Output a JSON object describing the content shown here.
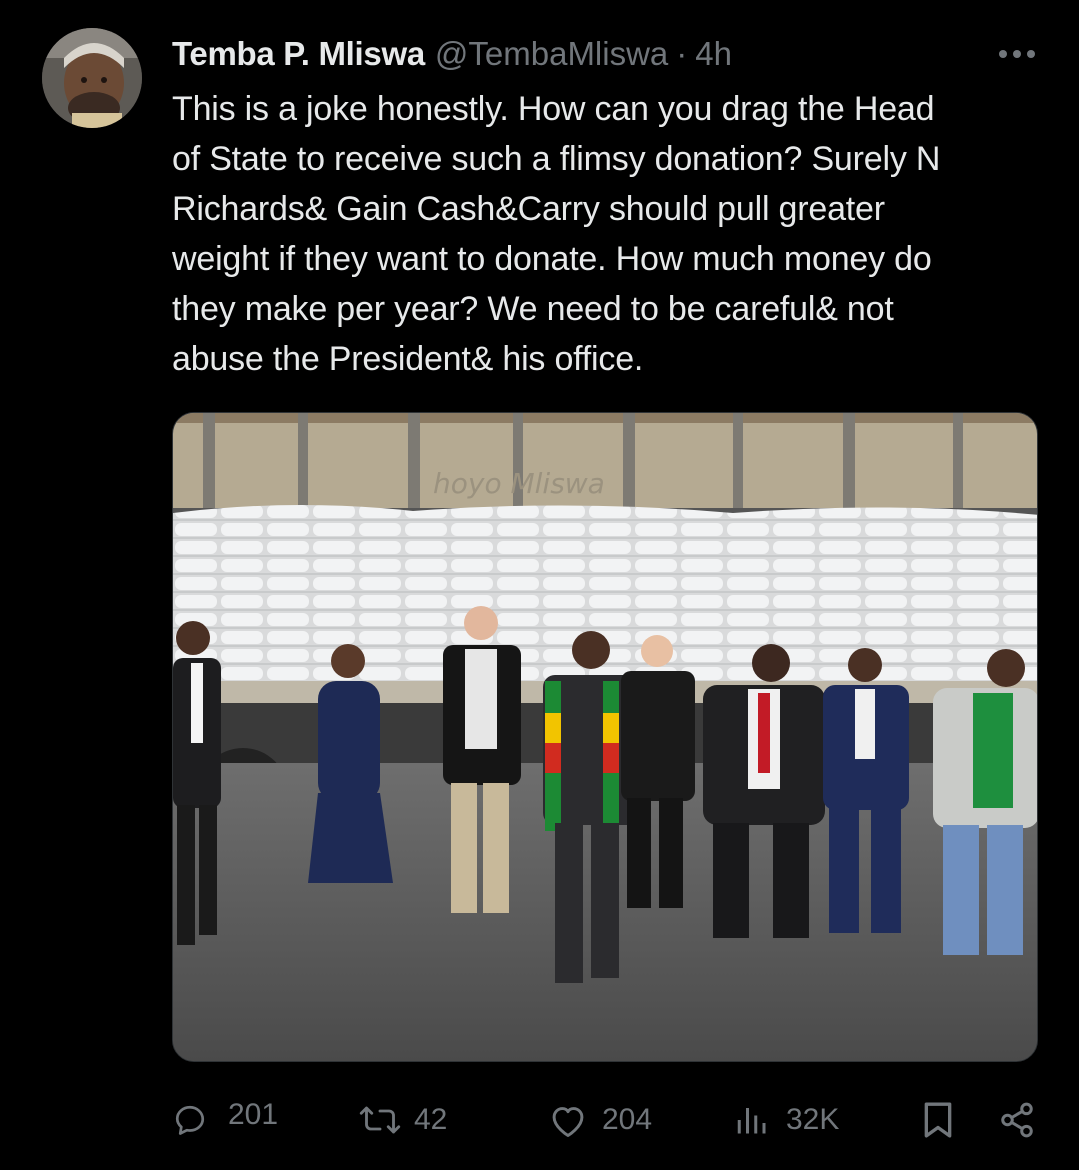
{
  "tweet": {
    "display_name": "Temba P. Mliswa",
    "handle": "@TembaMliswa",
    "separator": "·",
    "timestamp": "4h",
    "text": "This is a joke honestly. How can you drag the Head\nof State to receive such a flimsy donation? Surely N\nRichards& Gain Cash&Carry should pull greater\nweight if they want to donate. How much money do\nthey make per year? We need to be careful& not\nabuse the President& his office.",
    "media": {
      "background_text": "hoyo Mliswa"
    }
  },
  "actions": {
    "reply": {
      "icon": "reply-icon",
      "count": "201"
    },
    "retweet": {
      "icon": "retweet-icon",
      "count": "42"
    },
    "like": {
      "icon": "heart-icon",
      "count": "204"
    },
    "views": {
      "icon": "views-icon",
      "count": "32K"
    },
    "bookmark": {
      "icon": "bookmark-icon"
    },
    "share": {
      "icon": "share-icon"
    }
  },
  "colors": {
    "background": "#000000",
    "text": "#e7e9ea",
    "muted": "#71767b",
    "border": "#2f3336"
  }
}
